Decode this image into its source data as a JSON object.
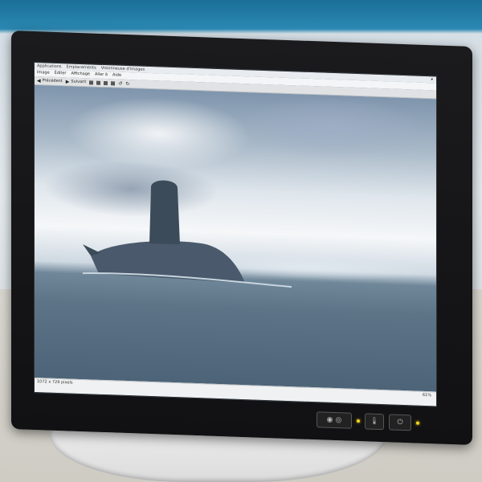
{
  "app": {
    "menubar": [
      "Applications",
      "Emplacements"
    ],
    "window_title": "Visionneuse d'images"
  },
  "menu": {
    "items": [
      "Image",
      "Éditer",
      "Affichage",
      "Aller à",
      "Aide"
    ]
  },
  "toolbar": {
    "previous_label": "Précédent",
    "next_label": "Suivant",
    "icons": [
      "square-icon",
      "square-icon",
      "square-icon",
      "square-icon",
      "rotate-left-icon",
      "rotate-right-icon"
    ]
  },
  "viewer": {
    "image_subject": "submarine at sea",
    "colors": {
      "sky": "#dfe6ec",
      "sea": "#5d7487",
      "hull": "#4a5a6c"
    }
  },
  "statusbar": {
    "left_text": "1072 x 729 pixels",
    "zoom_text": "61%"
  },
  "monitor_panel": {
    "buttons": [
      "input-select-button",
      "brightness-button",
      "power-button"
    ],
    "led_color": "#f5d51a"
  }
}
